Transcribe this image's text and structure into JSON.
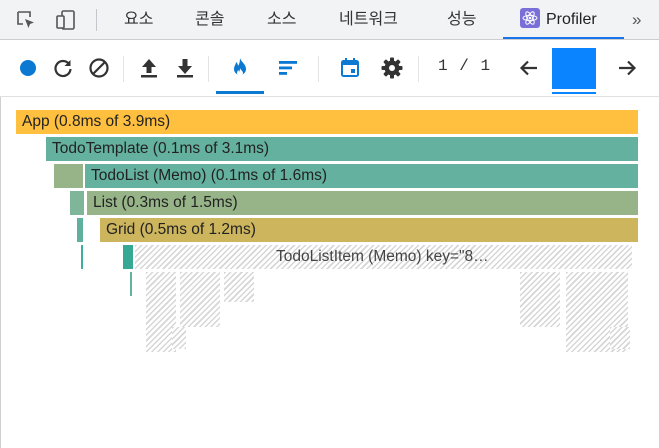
{
  "devtools_tabs": [
    {
      "label": "요소"
    },
    {
      "label": "콘솔"
    },
    {
      "label": "소스"
    },
    {
      "label": "네트워크"
    },
    {
      "label": "성능"
    },
    {
      "label": "Profiler",
      "active": true
    }
  ],
  "icons": {
    "inspect": "inspect-element-icon",
    "device": "device-toggle-icon",
    "react": "react-logo-icon",
    "overflow": "chevron-double-right-icon"
  },
  "overflow_glyph": "»",
  "toolbar": {
    "record": "record-icon",
    "reload": "reload-and-profile-icon",
    "clear": "clear-icon",
    "load": "load-profile-icon",
    "save": "save-profile-icon",
    "flamegraph": "flame-icon",
    "ranked": "ranked-chart-icon",
    "timeline": "calendar-icon",
    "settings": "gear-icon",
    "commit_current": "1",
    "commit_sep": "/",
    "commit_total": "1",
    "prev": "arrow-left-icon",
    "next": "arrow-right-icon"
  },
  "colors": {
    "accent": "#1a73e8",
    "record": "#0b78d1",
    "commit_bar": "#0a84ff",
    "app": "#ffbf3f",
    "todo_template": "#63b19e",
    "todo_list": "#63b19e",
    "list": "#97b488",
    "grid": "#cdb55d"
  },
  "flamegraph": {
    "rows": [
      {
        "label": "App (0.8ms of 3.9ms)",
        "color": "#ffbf3f"
      },
      {
        "label": "TodoTemplate (0.1ms of 3.1ms)",
        "color": "#63b19e"
      },
      {
        "label": "TodoList (Memo) (0.1ms of 1.6ms)",
        "color": "#63b19e"
      },
      {
        "label": "List (0.3ms of 1.5ms)",
        "color": "#97b488"
      },
      {
        "label": "Grid (0.5ms of 1.2ms)",
        "color": "#cdb55d"
      }
    ],
    "hatched_label": "TodoListItem (Memo) key=\"8…"
  }
}
